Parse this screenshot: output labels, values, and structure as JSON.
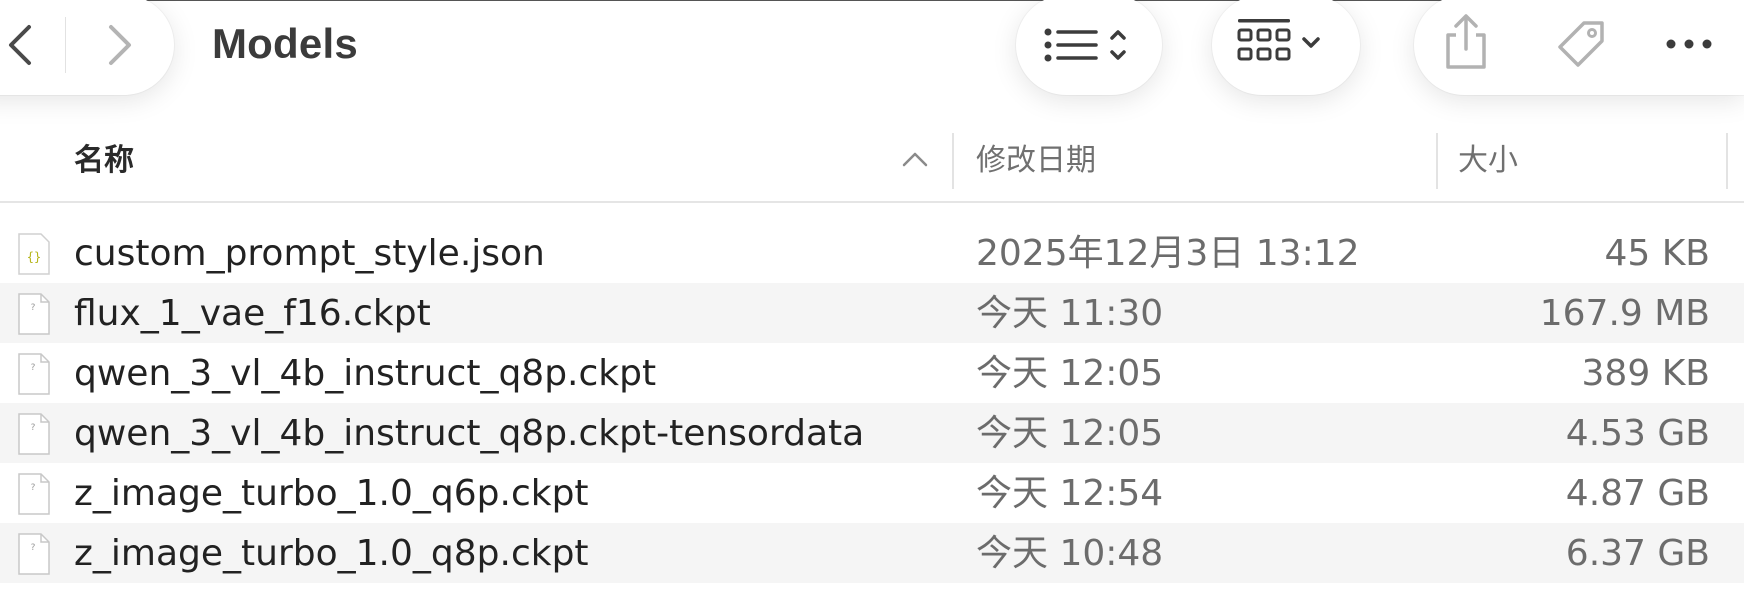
{
  "window": {
    "title": "Models"
  },
  "toolbar": {
    "back_icon": "chevron-left-icon",
    "forward_icon": "chevron-right-icon",
    "view_list_icon": "list-view-icon",
    "view_grid_icon": "icon-grid-view-icon",
    "share_icon": "share-icon",
    "tag_icon": "tag-icon",
    "more_icon": "ellipsis-icon"
  },
  "columns": {
    "name": "名称",
    "date": "修改日期",
    "size": "大小",
    "sort_icon": "chevron-up-icon"
  },
  "files": [
    {
      "name": "custom_prompt_style.json",
      "date": "2025年12月3日 13:12",
      "size": "45 KB",
      "type": "json"
    },
    {
      "name": "flux_1_vae_f16.ckpt",
      "date": "今天 11:30",
      "size": "167.9 MB",
      "type": "generic"
    },
    {
      "name": "qwen_3_vl_4b_instruct_q8p.ckpt",
      "date": "今天 12:05",
      "size": "389 KB",
      "type": "generic"
    },
    {
      "name": "qwen_3_vl_4b_instruct_q8p.ckpt-tensordata",
      "date": "今天 12:05",
      "size": "4.53 GB",
      "type": "generic"
    },
    {
      "name": "z_image_turbo_1.0_q6p.ckpt",
      "date": "今天 12:54",
      "size": "4.87 GB",
      "type": "generic"
    },
    {
      "name": "z_image_turbo_1.0_q8p.ckpt",
      "date": "今天 10:48",
      "size": "6.37 GB",
      "type": "generic"
    }
  ],
  "colors": {
    "row_alt": "#f5f5f5",
    "text_primary": "#222222",
    "text_secondary": "#6c6c6c",
    "json_icon_accent": "#b5b51a"
  }
}
